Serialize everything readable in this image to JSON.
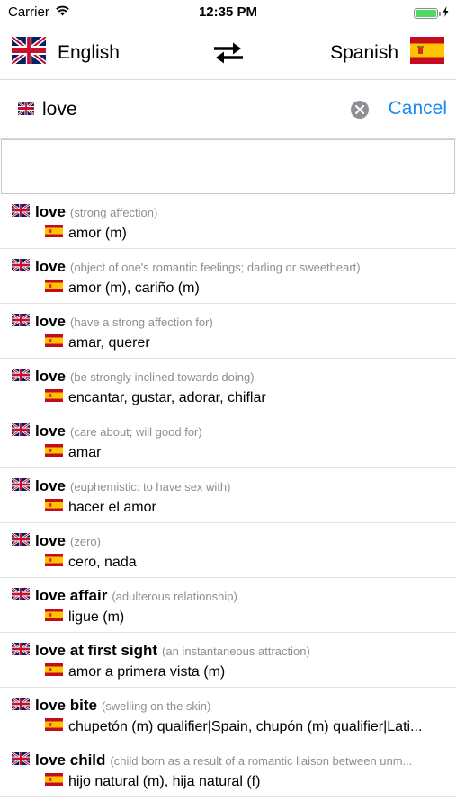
{
  "status_bar": {
    "carrier": "Carrier",
    "time": "12:35 PM",
    "battery_level": 1.0
  },
  "languages": {
    "source": {
      "label": "English",
      "flag": "uk-flag-icon"
    },
    "target": {
      "label": "Spanish",
      "flag": "spain-flag-icon"
    },
    "swap_icon": "swap-arrows-icon"
  },
  "search": {
    "value": "love",
    "cancel_label": "Cancel",
    "clear_icon": "clear-icon"
  },
  "colors": {
    "accent": "#1a8cf0",
    "gloss": "#8e8e93",
    "uk_blue": "#012169",
    "uk_red": "#C8102E",
    "spain_red": "#C60B1E",
    "spain_yellow": "#FFC400",
    "battery_green": "#4cd964"
  },
  "results": [
    {
      "term": "love",
      "gloss": "(strong affection)",
      "translation": "amor (m)"
    },
    {
      "term": "love",
      "gloss": "(object of one's romantic feelings; darling or sweetheart)",
      "translation": "amor (m), cariño (m)"
    },
    {
      "term": "love",
      "gloss": "(have a strong affection for)",
      "translation": "amar, querer"
    },
    {
      "term": "love",
      "gloss": "(be strongly inclined towards doing)",
      "translation": "encantar, gustar, adorar, chiflar"
    },
    {
      "term": "love",
      "gloss": "(care about; will good for)",
      "translation": "amar"
    },
    {
      "term": "love",
      "gloss": "(euphemistic: to have sex with)",
      "translation": "hacer el amor"
    },
    {
      "term": "love",
      "gloss": "(zero)",
      "translation": "cero, nada"
    },
    {
      "term": "love affair",
      "gloss": "(adulterous relationship)",
      "translation": "ligue (m)"
    },
    {
      "term": "love at first sight",
      "gloss": "(an instantaneous attraction)",
      "translation": "amor a primera vista (m)"
    },
    {
      "term": "love bite",
      "gloss": "(swelling on the skin)",
      "translation": "chupetón (m) qualifier|Spain, chupón (m) qualifier|Lati..."
    },
    {
      "term": "love child",
      "gloss": "(child born as a result of a romantic liaison between unm...",
      "translation": "hijo natural (m), hija natural (f)"
    }
  ]
}
